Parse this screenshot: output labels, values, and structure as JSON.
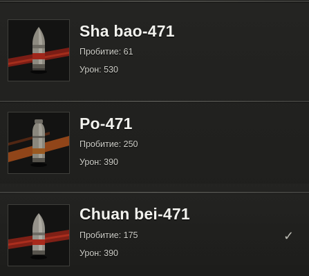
{
  "shells": [
    {
      "name": "Sha bao-471",
      "pen_label": "Пробитие:",
      "pen_value": "61",
      "dmg_label": "Урон:",
      "dmg_value": "530",
      "icon": "he-shell-icon",
      "selected": false
    },
    {
      "name": "Po-471",
      "pen_label": "Пробитие:",
      "pen_value": "250",
      "dmg_label": "Урон:",
      "dmg_value": "390",
      "icon": "heat-shell-icon",
      "selected": false
    },
    {
      "name": "Chuan bei-471",
      "pen_label": "Пробитие:",
      "pen_value": "175",
      "dmg_label": "Урон:",
      "dmg_value": "390",
      "icon": "ap-shell-icon",
      "selected": true
    }
  ],
  "selected_mark": "✓",
  "colors": {
    "background": "#1f1f1d",
    "name_text": "#f2f2ee",
    "stat_text": "#cfcfc9",
    "stripe_red": "#b2281c",
    "stripe_orange": "#c2561e"
  }
}
